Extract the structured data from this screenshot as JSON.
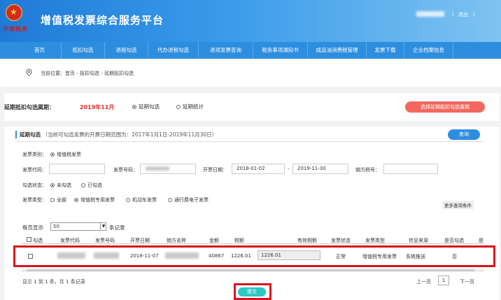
{
  "header": {
    "app_title": "增值税发票综合服务平台",
    "logo_text": "中国税务",
    "separator": "|",
    "logout": "退出"
  },
  "nav": {
    "items": [
      {
        "label": "首页",
        "w": 62
      },
      {
        "label": "抵扣勾选",
        "w": 62
      },
      {
        "label": "退税勾选",
        "w": 62
      },
      {
        "label": "代办退税勾选",
        "w": 72
      },
      {
        "label": "进项发票查询",
        "w": 78
      },
      {
        "label": "税务事项通知书",
        "w": 78
      },
      {
        "label": "成品油消费税管理",
        "w": 84
      },
      {
        "label": "发票下载",
        "w": 54
      },
      {
        "label": "企业档案信息",
        "w": 70
      }
    ]
  },
  "breadcrumb": {
    "text": "当前位置：首页 - 抵扣勾选 - 延期抵扣勾选"
  },
  "period": {
    "label": "延期抵扣勾选属期：",
    "value": "2019年11月",
    "option_select": "延期勾选",
    "option_stats": "延期统计",
    "select_button": "选择延期抵扣勾选属期"
  },
  "section": {
    "title": "延期勾选",
    "hint": "（当前可勾选发票的开票日期范围为：2017年1月1日-2019年11月30日）",
    "query_button": "查询"
  },
  "filters": {
    "invoice_category_label": "发票类别：",
    "invoice_category_value": "增值税发票",
    "invoice_code_label": "发票代码：",
    "invoice_number_label": "发票号码：",
    "issue_date_label": "开票日期：",
    "date_from": "2018-01-02",
    "date_sep": "-",
    "date_to": "2019-11-30",
    "seller_tax_label": "销方税号：",
    "check_status_label": "勾选状态：",
    "status_unchecked": "未勾选",
    "status_checked": "已勾选",
    "invoice_type_label": "发票类型：",
    "type_all": "全部",
    "type_special": "增值税专用发票",
    "type_vehicle": "机动车发票",
    "type_toll": "通行费电子发票",
    "more_conditions": "更多查询条件"
  },
  "table": {
    "page_size_label": "每页显示",
    "page_size_value": "50",
    "page_size_suffix": "条记录",
    "headers": [
      "勾选",
      "发票代码",
      "发票号码",
      "开票日期",
      "销方名称",
      "金额",
      "税额",
      "有效税额",
      "发票状态",
      "发票类型",
      "信息来源",
      "是否勾选",
      "是"
    ],
    "row": {
      "issue_date": "2018-11-07",
      "amount": "40867",
      "tax": "1226.01",
      "valid_tax": "1226.01",
      "status": "正常",
      "type": "增值税专用发票",
      "source": "系统推送",
      "checked": "否"
    },
    "summary": "显示 1 到 1 条，共 1 条记录",
    "pager_prev": "上一页",
    "pager_current": "1",
    "pager_next": "下一页"
  },
  "submit_button": "提交"
}
